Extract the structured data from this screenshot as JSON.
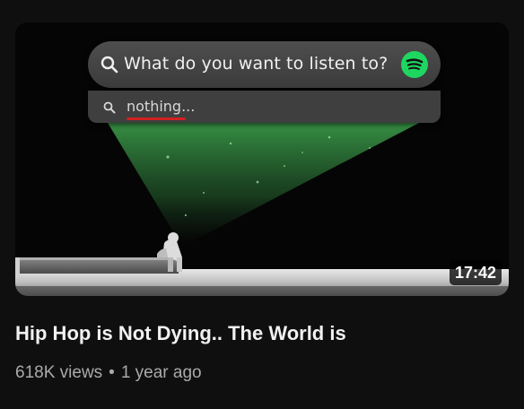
{
  "video": {
    "title": "Hip Hop is Not Dying.. The World is",
    "views": "618K views",
    "separator": "•",
    "age": "1 year ago",
    "duration": "17:42"
  },
  "thumbnail": {
    "search_prompt": "What do you want to listen to?",
    "search_query": "nothing...",
    "icons": [
      "search-icon",
      "spotify-logo-icon"
    ],
    "colors": {
      "spotify_green": "#1ed760",
      "beam_green": "#3fa84f",
      "underline_red": "#d32020",
      "background": "#0f0f0f"
    }
  }
}
